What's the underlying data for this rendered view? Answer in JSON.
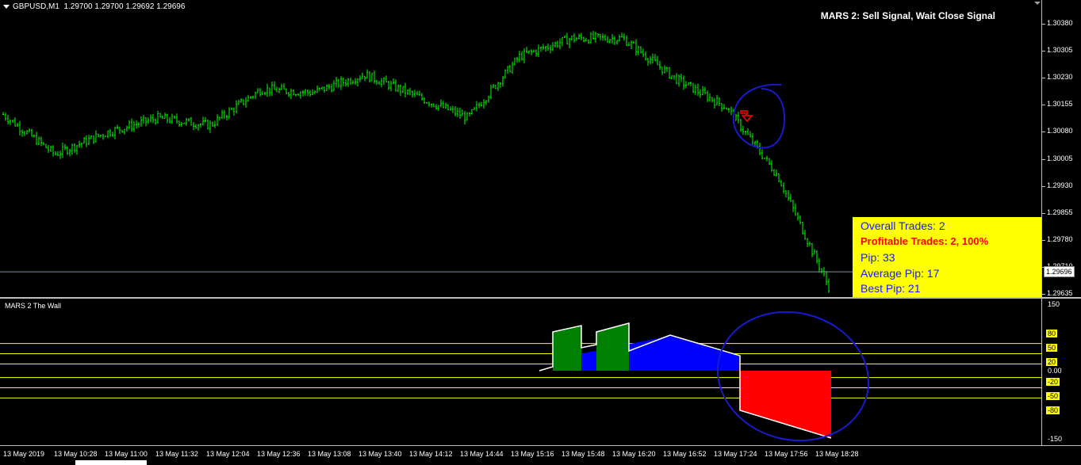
{
  "header": {
    "symbol": "GBPUSD,M1",
    "ohlc": "1.29700 1.29700 1.29692 1.29696"
  },
  "signal": {
    "text": "MARS 2: Sell Signal, Wait Close Signal"
  },
  "stats": {
    "overall": "Overall Trades: 2",
    "profitable": "Profitable Trades: 2, 100%",
    "pip": "Pip: 33",
    "average": "Average Pip: 17",
    "best": "Best Pip: 21"
  },
  "price_axis": {
    "ticks": [
      "1.30380",
      "1.30305",
      "1.30230",
      "1.30155",
      "1.30080",
      "1.30005",
      "1.29930",
      "1.29855",
      "1.29780",
      "1.29710",
      "1.29635"
    ],
    "current": "1.29696"
  },
  "indicator": {
    "title": "MARS 2 The Wall",
    "ticks": [
      "150",
      "80",
      "50",
      "20",
      "0.00",
      "-20",
      "-50",
      "-80",
      "-150"
    ],
    "highlighted": [
      "80",
      "50",
      "20",
      "-20",
      "-50",
      "-80"
    ]
  },
  "time_axis": {
    "labels": [
      "13 May 2019",
      "13 May 10:28",
      "13 May 11:00",
      "13 May 11:32",
      "13 May 12:04",
      "13 May 12:36",
      "13 May 13:08",
      "13 May 13:40",
      "13 May 14:12",
      "13 May 14:44",
      "13 May 15:16",
      "13 May 15:48",
      "13 May 16:20",
      "13 May 16:52",
      "13 May 17:24",
      "13 May 17:56",
      "13 May 18:28"
    ]
  },
  "colors": {
    "bars": "#00ff00",
    "stats_bg": "#ffff00",
    "stats_text": "#1a1aff",
    "profit_text": "#ff0000",
    "ind_green": "#008000",
    "ind_blue": "#0000ff",
    "ind_red": "#ff0000",
    "level_line": "#ffff00",
    "annotation": "#1a1acc"
  },
  "chart_data": [
    {
      "type": "line",
      "title": "GBPUSD,M1",
      "ylim": [
        1.29625,
        1.3042
      ],
      "x": [
        "13 May 10:00",
        "13 May 10:28",
        "13 May 11:00",
        "13 May 11:32",
        "13 May 12:04",
        "13 May 12:36",
        "13 May 13:08",
        "13 May 13:40",
        "13 May 14:12",
        "13 May 14:44",
        "13 May 15:16",
        "13 May 15:48",
        "13 May 16:20",
        "13 May 16:52",
        "13 May 17:24",
        "13 May 17:56",
        "13 May 18:28"
      ],
      "series": [
        {
          "values": [
            1.3013,
            1.3002,
            1.3008,
            1.3012,
            1.301,
            1.302,
            1.3019,
            1.3024,
            1.3018,
            1.3012,
            1.3029,
            1.3034,
            1.3034,
            1.3023,
            1.3015,
            1.2996,
            1.2965
          ]
        }
      ]
    },
    {
      "type": "area",
      "title": "MARS 2 The Wall",
      "ylim": [
        -150,
        150
      ],
      "levels": [
        80,
        50,
        20,
        -20,
        -50,
        -80
      ],
      "x": [
        "13 May 15:16",
        "13 May 15:48",
        "13 May 16:20",
        "13 May 16:52",
        "13 May 17:24",
        "13 May 17:56",
        "13 May 18:28"
      ],
      "series": [
        {
          "values": [
            0,
            45,
            60,
            75,
            40,
            -80,
            -140
          ]
        }
      ]
    }
  ]
}
